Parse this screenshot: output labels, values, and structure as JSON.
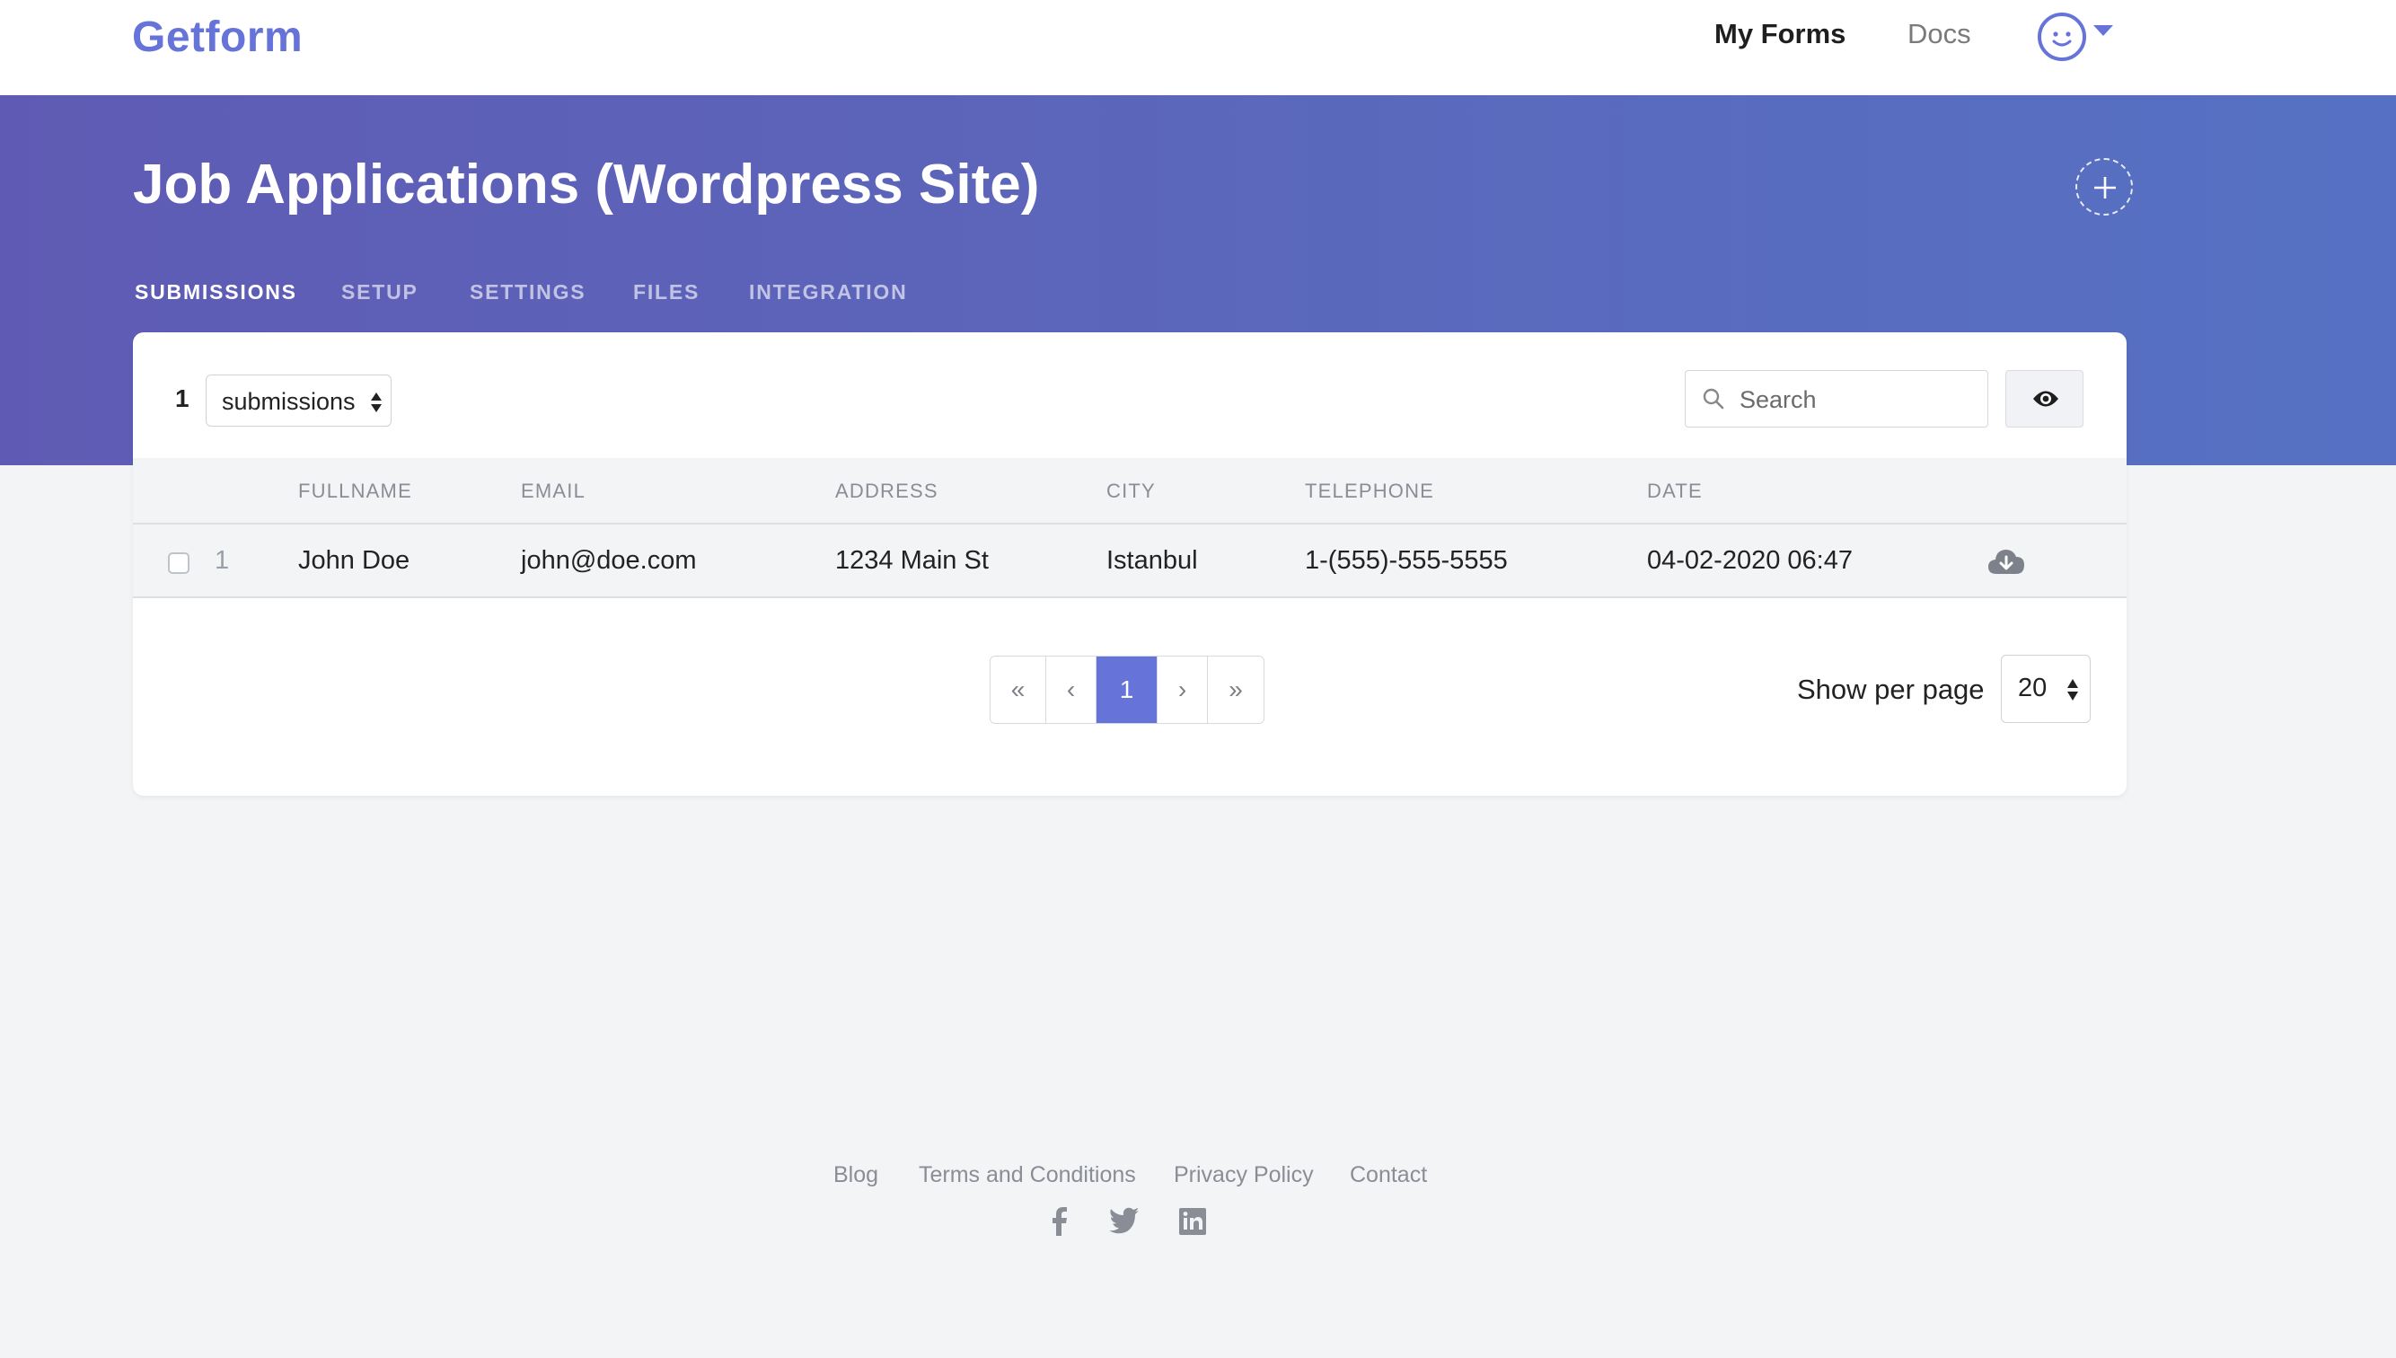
{
  "brand": {
    "logo": "Getform",
    "accent": "#6673d8"
  },
  "nav": {
    "my_forms": "My Forms",
    "docs": "Docs",
    "avatar_icon": "smiley-avatar-icon"
  },
  "hero": {
    "title": "Job Applications (Wordpress Site)",
    "tabs": [
      {
        "label": "SUBMISSIONS",
        "active": true
      },
      {
        "label": "SETUP"
      },
      {
        "label": "SETTINGS"
      },
      {
        "label": "FILES"
      },
      {
        "label": "INTEGRATION"
      }
    ]
  },
  "toolbar": {
    "count": "1",
    "view_select": "submissions",
    "search_placeholder": "Search"
  },
  "table": {
    "headers": [
      "FULLNAME",
      "EMAIL",
      "ADDRESS",
      "CITY",
      "TELEPHONE",
      "DATE"
    ],
    "rows": [
      {
        "num": "1",
        "fullname": "John Doe",
        "email": "john@doe.com",
        "address": "1234 Main St",
        "city": "Istanbul",
        "telephone": "1-(555)-555-5555",
        "date": "04-02-2020 06:47"
      }
    ]
  },
  "pagination": {
    "first": "«",
    "prev": "‹",
    "current": "1",
    "next": "›",
    "last": "»",
    "per_page_label": "Show per page",
    "per_page": "20"
  },
  "footer": {
    "links": [
      "Blog",
      "Terms and Conditions",
      "Privacy Policy",
      "Contact"
    ],
    "social": [
      "facebook-icon",
      "twitter-icon",
      "linkedin-icon"
    ]
  }
}
